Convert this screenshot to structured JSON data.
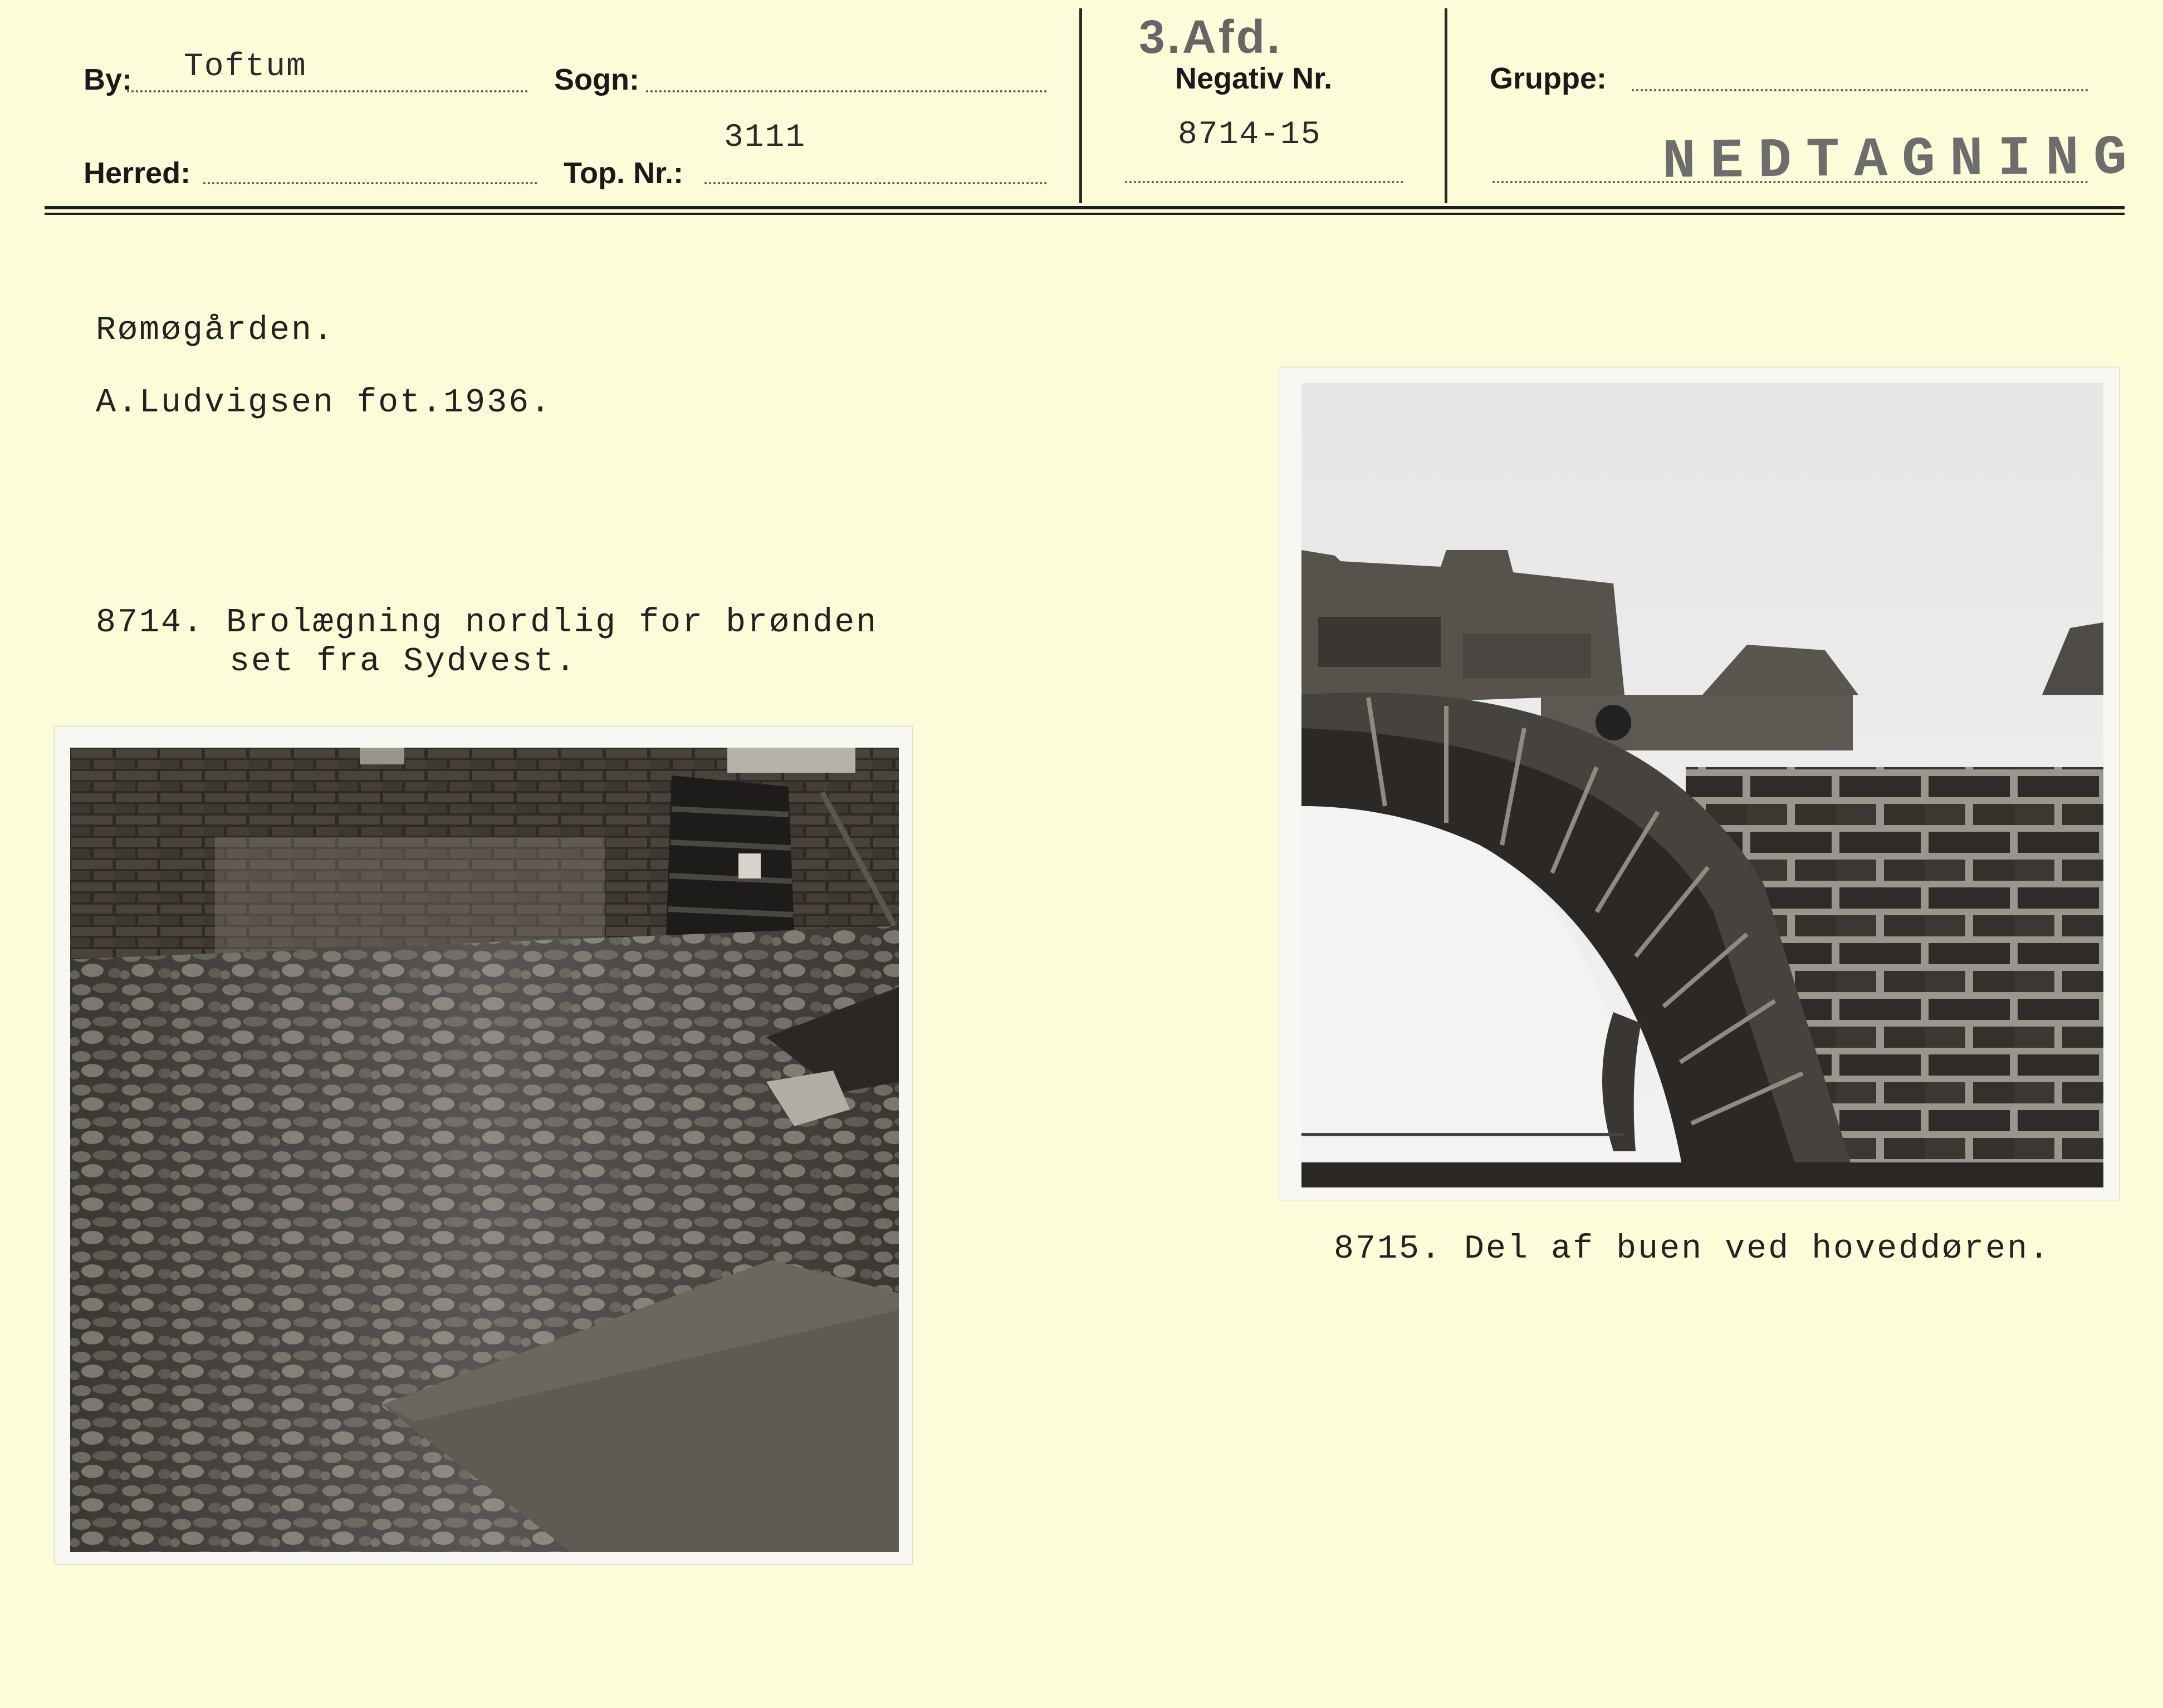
{
  "header": {
    "by_label": "By:",
    "by_value": "Toftum",
    "sogn_label": "Sogn:",
    "sogn_value": "",
    "herred_label": "Herred:",
    "herred_value": "",
    "top_nr_label": "Top. Nr.:",
    "top_nr_value": "3111",
    "afd_note": "3.Afd.",
    "negativ_label": "Negativ Nr.",
    "negativ_value": "8714-15",
    "gruppe_label": "Gruppe:",
    "gruppe_value": "",
    "stamp_text": "NEDTAGNING"
  },
  "content": {
    "title": "Rømøgården.",
    "photographer": "A.Ludvigsen fot.1936.",
    "caption_left_line1": "8714. Brolægning nordlig for brønden",
    "caption_left_line2": "set fra Sydvest.",
    "caption_right": "8715. Del af buen ved hoveddøren."
  },
  "photos": {
    "left_icon": "cobblestone-courtyard-photo",
    "right_icon": "brick-arch-photo"
  }
}
